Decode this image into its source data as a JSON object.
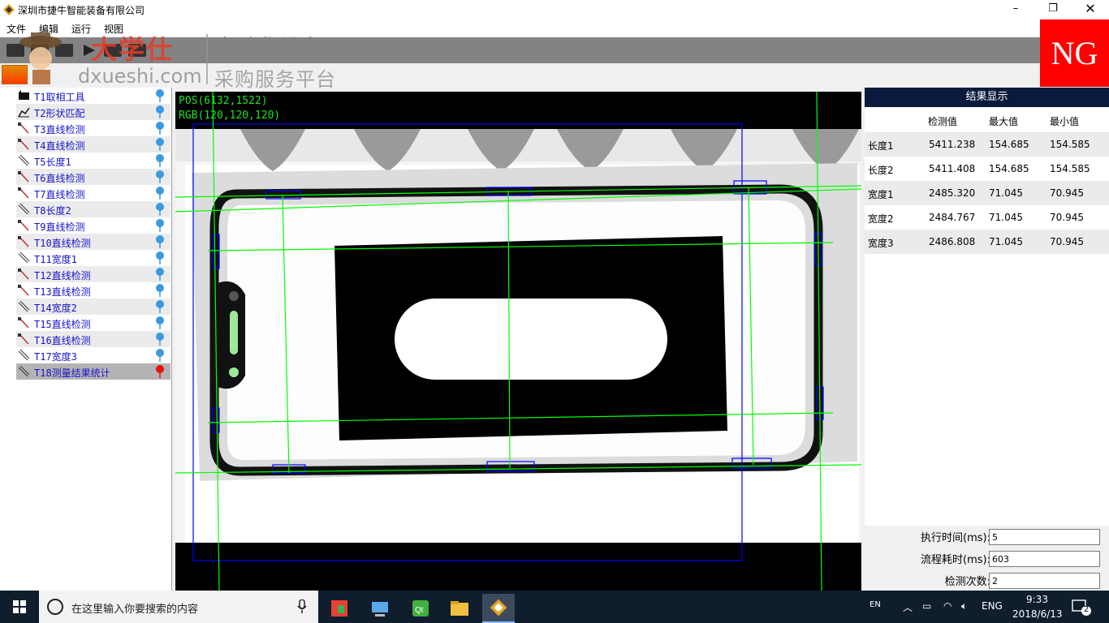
{
  "window": {
    "title": "深圳市捷牛智能装备有限公司",
    "min": "–",
    "max": "❐",
    "close": "✕"
  },
  "menu": [
    "文件",
    "编辑",
    "运行",
    "视图"
  ],
  "watermark": {
    "brand_cn": "大学仕",
    "brand_en": "dxueshi.com",
    "line1": "自动化设备",
    "line2": "采购服务平台"
  },
  "ng_badge": "NG",
  "tree": [
    {
      "label": "T1取相工具",
      "icon": "camera-tool-icon",
      "pin": "blue"
    },
    {
      "label": "T2形状匹配",
      "icon": "shape-match-icon",
      "pin": "blue"
    },
    {
      "label": "T3直线检测",
      "icon": "line-detect-icon",
      "pin": "blue"
    },
    {
      "label": "T4直线检测",
      "icon": "line-detect-icon",
      "pin": "blue"
    },
    {
      "label": "T5长度1",
      "icon": "length-measure-icon",
      "pin": "blue"
    },
    {
      "label": "T6直线检测",
      "icon": "line-detect-icon",
      "pin": "blue"
    },
    {
      "label": "T7直线检测",
      "icon": "line-detect-icon",
      "pin": "blue"
    },
    {
      "label": "T8长度2",
      "icon": "length-measure-icon",
      "pin": "blue"
    },
    {
      "label": "T9直线检测",
      "icon": "line-detect-icon",
      "pin": "blue"
    },
    {
      "label": "T10直线检测",
      "icon": "line-detect-icon",
      "pin": "blue"
    },
    {
      "label": "T11宽度1",
      "icon": "length-measure-icon",
      "pin": "blue"
    },
    {
      "label": "T12直线检测",
      "icon": "line-detect-icon",
      "pin": "blue"
    },
    {
      "label": "T13直线检测",
      "icon": "line-detect-icon",
      "pin": "blue"
    },
    {
      "label": "T14宽度2",
      "icon": "length-measure-icon",
      "pin": "blue"
    },
    {
      "label": "T15直线检测",
      "icon": "line-detect-icon",
      "pin": "blue"
    },
    {
      "label": "T16直线检测",
      "icon": "line-detect-icon",
      "pin": "blue"
    },
    {
      "label": "T17宽度3",
      "icon": "length-measure-icon",
      "pin": "blue"
    },
    {
      "label": "T18测量结果统计",
      "icon": "length-measure-icon",
      "pin": "red"
    }
  ],
  "image_view": {
    "pos": "POS(6132,1522)",
    "rgb": "RGB(120,120,120)"
  },
  "results": {
    "title": "结果显示",
    "columns": [
      "检测值",
      "最大值",
      "最小值"
    ],
    "rows": [
      {
        "name": "长度1",
        "value": "5411.238",
        "max": "154.685",
        "min": "154.585"
      },
      {
        "name": "长度2",
        "value": "5411.408",
        "max": "154.685",
        "min": "154.585"
      },
      {
        "name": "宽度1",
        "value": "2485.320",
        "max": "71.045",
        "min": "70.945"
      },
      {
        "name": "宽度2",
        "value": "2484.767",
        "max": "71.045",
        "min": "70.945"
      },
      {
        "name": "宽度3",
        "value": "2486.808",
        "max": "71.045",
        "min": "70.945"
      }
    ]
  },
  "stats": {
    "exec_time_label": "执行时间(ms):",
    "exec_time_value": "5",
    "flow_time_label": "流程耗时(ms):",
    "flow_time_value": "603",
    "count_label": "检测次数:",
    "count_value": "2"
  },
  "taskbar": {
    "search_placeholder": "在这里输入你要搜索的内容",
    "ime": "EN",
    "lang": "ENG",
    "time": "9:33",
    "date": "2018/6/13",
    "notifications": "2"
  },
  "colors": {
    "ng": "#ff0000",
    "overlay_line": "#00ff00",
    "roi_box": "#0000ff",
    "tree_text": "#1515c8"
  }
}
